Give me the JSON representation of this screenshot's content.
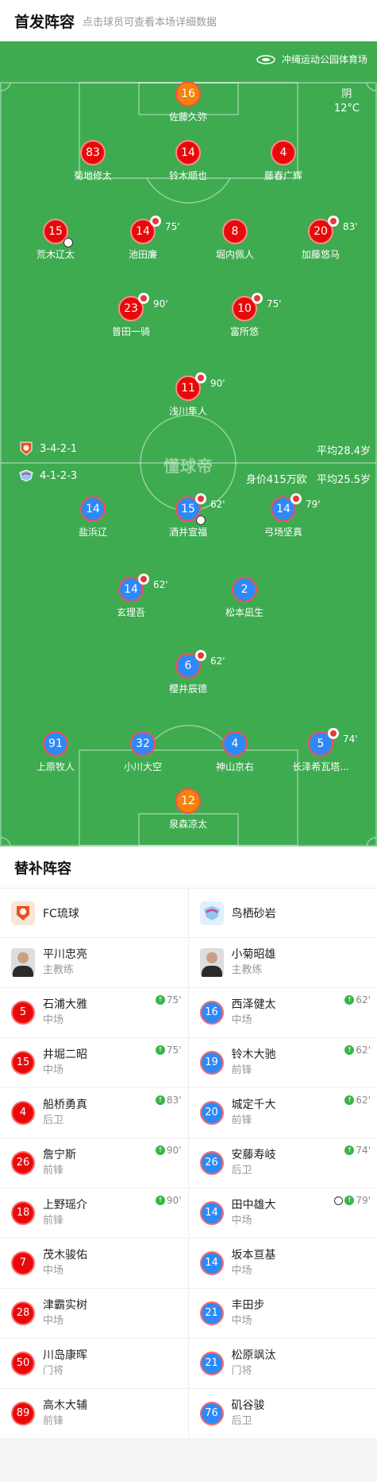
{
  "header": {
    "title": "首发阵容",
    "subtitle": "点击球员可查看本场详细数据"
  },
  "venue": {
    "name": "冲绳运动公园体育场",
    "weather": "阴",
    "temperature": "12°C"
  },
  "watermark": "懂球帝",
  "home_team": {
    "name": "FC琉球",
    "formation": "3-4-2-1",
    "avg_age": "平均28.4岁",
    "color": "#e80a0a"
  },
  "away_team": {
    "name": "鸟栖砂岩",
    "formation": "4-1-2-3",
    "market_value": "身价415万欧",
    "avg_age": "平均25.5岁",
    "color": "#2e89f5"
  },
  "home_lineup": [
    {
      "num": "16",
      "name": "佐藤久弥"
    },
    {
      "num": "83",
      "name": "菊地修太"
    },
    {
      "num": "14",
      "name": "铃木顺也"
    },
    {
      "num": "4",
      "name": "藤春广辉"
    },
    {
      "num": "15",
      "name": "荒木辽太"
    },
    {
      "num": "14",
      "name": "池田廉",
      "sub": "75'"
    },
    {
      "num": "8",
      "name": "堀内佩人"
    },
    {
      "num": "20",
      "name": "加藤悠马",
      "sub": "83'"
    },
    {
      "num": "23",
      "name": "普田一骑",
      "sub": "90'"
    },
    {
      "num": "10",
      "name": "富所悠",
      "sub": "75'"
    },
    {
      "num": "11",
      "name": "浅川隼人",
      "sub": "90'"
    }
  ],
  "away_lineup": [
    {
      "num": "14",
      "name": "盐浜辽"
    },
    {
      "num": "15",
      "name": "酒井宣福",
      "sub": "62'"
    },
    {
      "num": "14",
      "name": "弓场坚真",
      "sub": "79'"
    },
    {
      "num": "14",
      "name": "玄理吾",
      "sub": "62'"
    },
    {
      "num": "2",
      "name": "松本凪生"
    },
    {
      "num": "6",
      "name": "樱井辰德",
      "sub": "62'"
    },
    {
      "num": "91",
      "name": "上原牧人"
    },
    {
      "num": "32",
      "name": "小川大空"
    },
    {
      "num": "4",
      "name": "神山京右"
    },
    {
      "num": "5",
      "name": "长泽希瓦塔...",
      "sub": "74'"
    },
    {
      "num": "12",
      "name": "泉森凉太"
    }
  ],
  "subs_title": "替补阵容",
  "home_subs": {
    "coach": {
      "name": "平川忠亮",
      "role": "主教练"
    },
    "players": [
      {
        "num": "5",
        "name": "石浦大雅",
        "pos": "中场",
        "in": "75'"
      },
      {
        "num": "15",
        "name": "井堀二昭",
        "pos": "中场",
        "in": "75'"
      },
      {
        "num": "4",
        "name": "船桥勇真",
        "pos": "后卫",
        "in": "83'"
      },
      {
        "num": "26",
        "name": "詹宁斯",
        "pos": "前锋",
        "in": "90'"
      },
      {
        "num": "18",
        "name": "上野瑶介",
        "pos": "前锋",
        "in": "90'"
      },
      {
        "num": "7",
        "name": "茂木骏佑",
        "pos": "中场"
      },
      {
        "num": "28",
        "name": "津霸实树",
        "pos": "中场"
      },
      {
        "num": "50",
        "name": "川岛康晖",
        "pos": "门将"
      },
      {
        "num": "89",
        "name": "高木大辅",
        "pos": "前锋"
      }
    ]
  },
  "away_subs": {
    "coach": {
      "name": "小菊昭雄",
      "role": "主教练"
    },
    "players": [
      {
        "num": "16",
        "name": "西泽健太",
        "pos": "中场",
        "in": "62'"
      },
      {
        "num": "19",
        "name": "铃木大驰",
        "pos": "前锋",
        "in": "62'"
      },
      {
        "num": "20",
        "name": "城定千大",
        "pos": "前锋",
        "in": "62'"
      },
      {
        "num": "26",
        "name": "安藤寿岐",
        "pos": "后卫",
        "in": "74'"
      },
      {
        "num": "14",
        "name": "田中雄大",
        "pos": "中场",
        "in": "79'"
      },
      {
        "num": "14",
        "name": "坂本亘基",
        "pos": "中场"
      },
      {
        "num": "21",
        "name": "丰田步",
        "pos": "中场"
      },
      {
        "num": "21",
        "name": "松原飒汰",
        "pos": "门将"
      },
      {
        "num": "76",
        "name": "矶谷骏",
        "pos": "后卫"
      }
    ]
  }
}
